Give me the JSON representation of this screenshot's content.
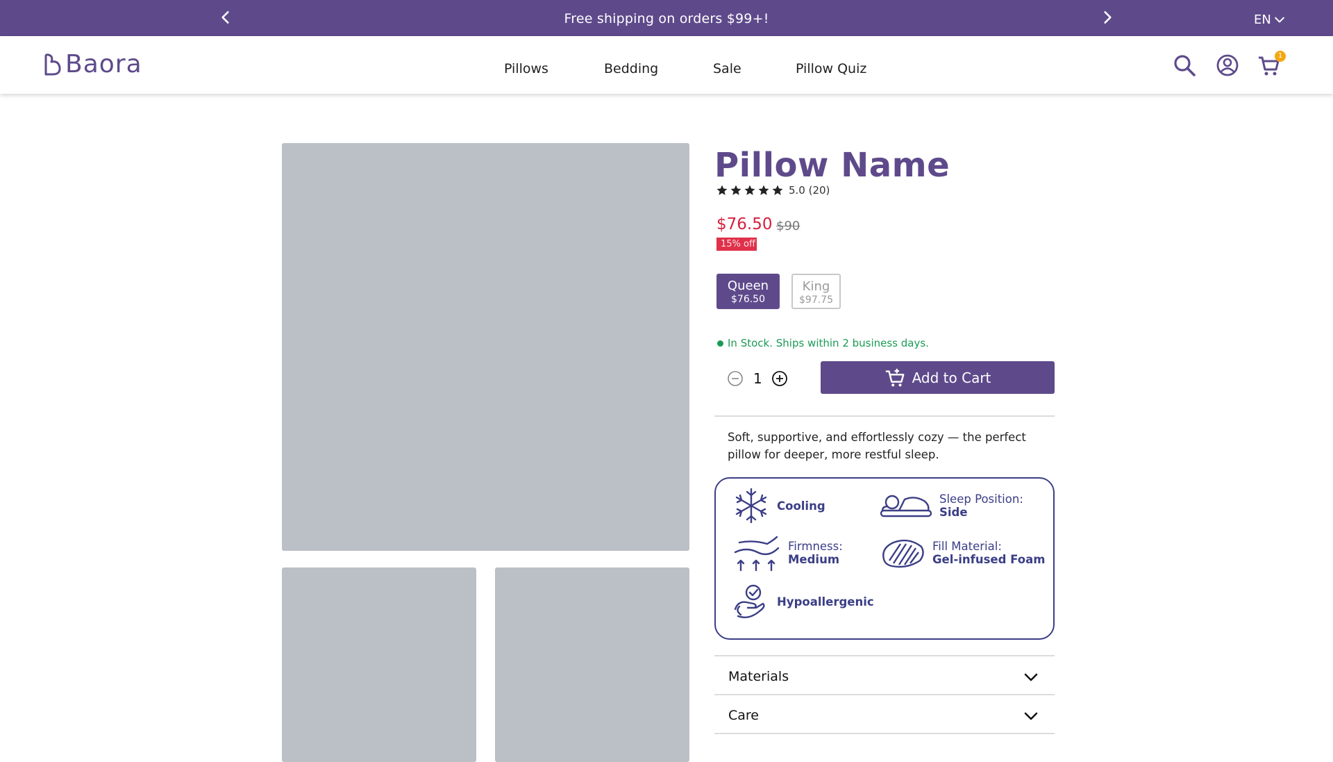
{
  "announcement": {
    "message": "Free shipping on orders $99+!",
    "lang": "EN"
  },
  "header": {
    "logo": "Baora",
    "nav": [
      "Pillows",
      "Bedding",
      "Sale",
      "Pillow Quiz"
    ],
    "cart_count": "1"
  },
  "product": {
    "title": "Pillow Name",
    "rating": "5.0 (20)",
    "stars": 5,
    "price_now": "$76.50",
    "price_was": "$90",
    "discount": "15% off",
    "sizes": [
      {
        "name": "Queen",
        "price": "$76.50",
        "selected": true
      },
      {
        "name": "King",
        "price": "$97.75",
        "selected": false
      }
    ],
    "stock": "In Stock. Ships within 2 business days.",
    "quantity": "1",
    "add_to_cart": "Add to Cart",
    "description": "Soft, supportive, and effortlessly cozy — the perfect pillow for deeper, more restful sleep."
  },
  "features": {
    "cooling": "Cooling",
    "sleep_label": "Sleep Position:",
    "sleep_value": "Side",
    "firmness_label": "Firmness:",
    "firmness_value": "Medium",
    "fill_label": "Fill Material:",
    "fill_value": "Gel-infused Foam",
    "hypo": "Hypoallergenic"
  },
  "accordion": [
    "Materials",
    "Care"
  ],
  "colors": {
    "brand": "#5e4a8b",
    "sale": "#d6203f",
    "stock": "#1a9b55",
    "feature": "#3b3e86",
    "placeholder": "#bbc0c6"
  }
}
